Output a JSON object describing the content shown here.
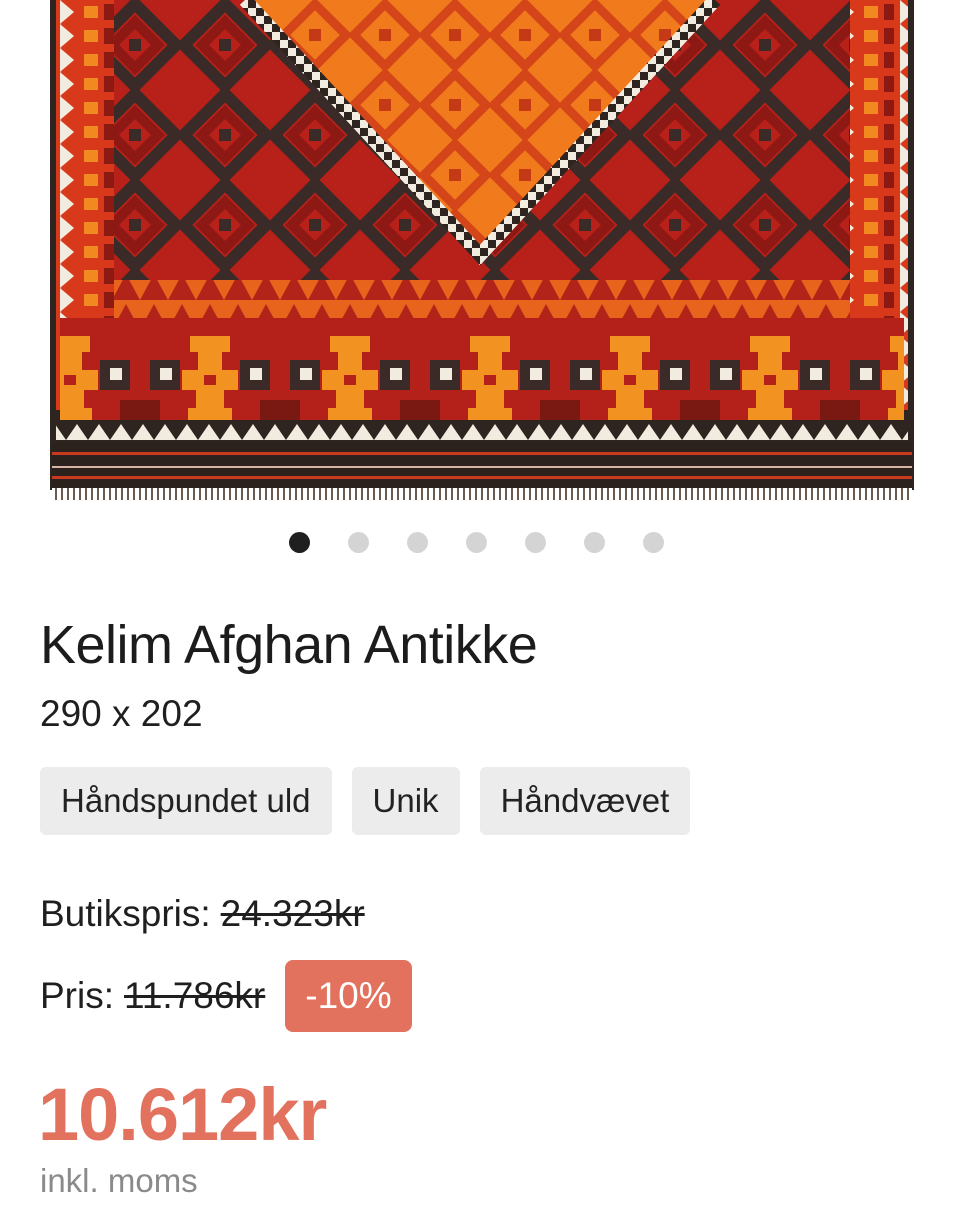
{
  "product": {
    "image_alt": "Kelim Afghan Antikke",
    "title": "Kelim Afghan Antikke",
    "size": "290 x 202",
    "tags": [
      "Håndspundet uld",
      "Unik",
      "Håndvævet"
    ]
  },
  "carousel": {
    "total": 7,
    "active_index": 0
  },
  "pricing": {
    "shop_price_label": "Butikspris:",
    "shop_price_value": "24.323kr",
    "price_label": "Pris:",
    "price_value": "11.786kr",
    "discount": "-10%",
    "final_price": "10.612kr",
    "vat_note": "inkl. moms"
  },
  "colors": {
    "accent": "#e2715d",
    "dot_active": "#1f1f1f",
    "dot_inactive": "#d4d4d4",
    "tag_bg": "#ececec"
  }
}
